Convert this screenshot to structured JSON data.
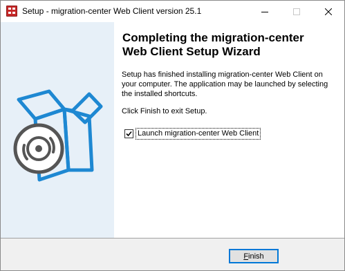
{
  "window": {
    "title": "Setup - migration-center Web Client version 25.1"
  },
  "content": {
    "heading": "Completing the migration-center Web Client Setup Wizard",
    "paragraph1": "Setup has finished installing migration-center Web Client on your computer. The application may be launched by selecting the installed shortcuts.",
    "paragraph2": "Click Finish to exit Setup.",
    "launch_checkbox": {
      "label": "Launch migration-center Web Client",
      "checked": true
    }
  },
  "footer": {
    "finish_label": "Finish",
    "finish_mnemonic": "F"
  },
  "icons": {
    "app": "setup-app-icon",
    "illustration": "box-with-disc-icon"
  },
  "colors": {
    "side_panel": "#e7f0f8",
    "box_stroke": "#1e88d2",
    "disc": "#555555"
  }
}
